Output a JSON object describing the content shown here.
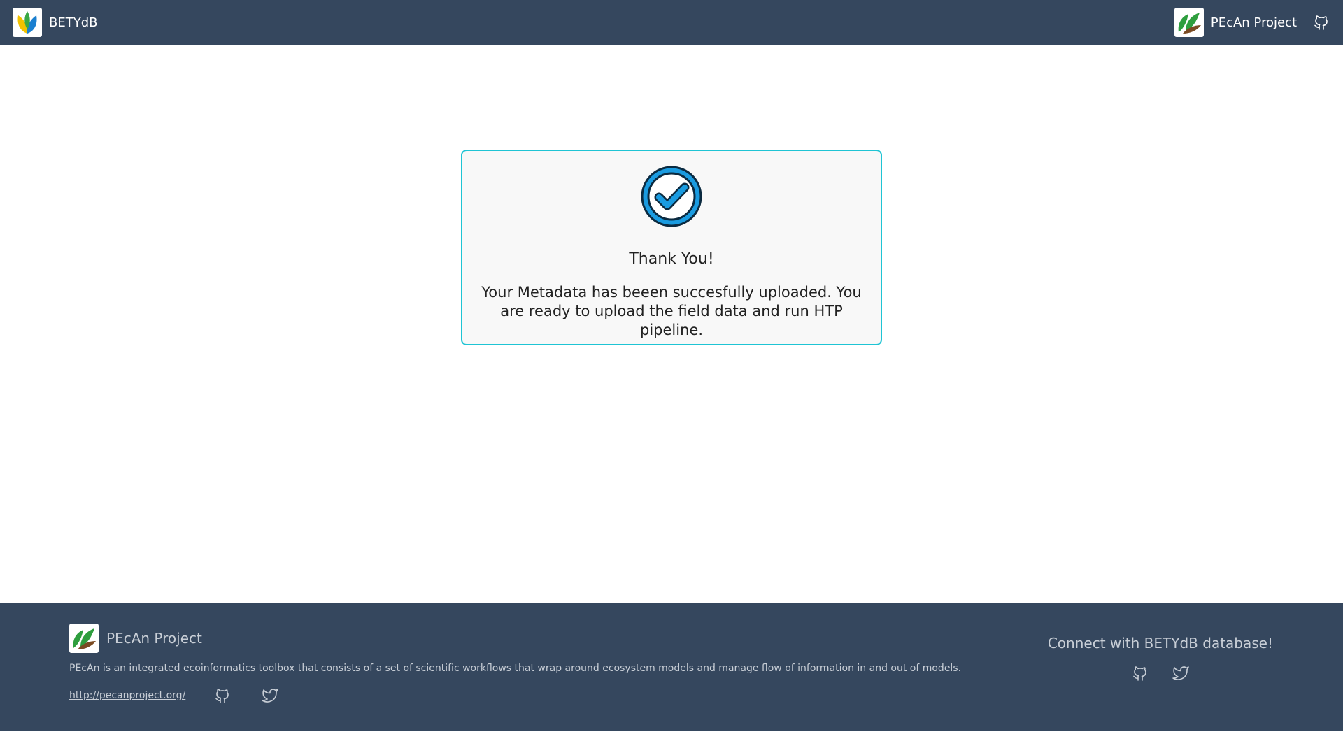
{
  "navbar": {
    "brand": "BETYdB",
    "brand_logo": "betydb-leaf-logo-icon",
    "right_brand": "PEcAn Project",
    "right_logo": "pecan-leaf-logo-icon",
    "github_icon": "github-icon"
  },
  "card": {
    "icon": "check-circle-icon",
    "title": "Thank You!",
    "message": "Your Metadata has beeen succesfully uploaded. You are ready to upload the field data and run HTP pipeline.",
    "border_color": "#1fc4d4",
    "check_color": "#1a9be0"
  },
  "footer": {
    "brand": "PEcAn Project",
    "description": "PEcAn is an integrated ecoinformatics toolbox that consists of a set of scientific workflows that wrap around ecosystem models and manage flow of information in and out of models.",
    "link": "http://pecanproject.org/",
    "connect_text": "Connect with BETYdB database!",
    "icons": [
      "github-icon",
      "twitter-icon"
    ]
  },
  "colors": {
    "header_bg": "#35475e",
    "footer_bg": "#35475e",
    "accent": "#1fc4d4"
  }
}
